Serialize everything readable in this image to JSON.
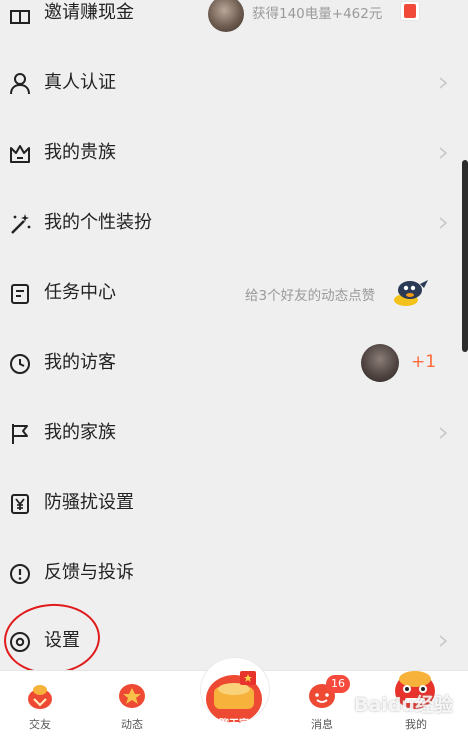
{
  "menu": {
    "items": [
      {
        "id": "invite",
        "label": "邀请赚现金",
        "hint": "获得140电量+462元"
      },
      {
        "id": "verify",
        "label": "真人认证"
      },
      {
        "id": "noble",
        "label": "我的贵族"
      },
      {
        "id": "dressup",
        "label": "我的个性装扮"
      },
      {
        "id": "tasks",
        "label": "任务中心",
        "hint": "给3个好友的动态点赞"
      },
      {
        "id": "visitors",
        "label": "我的访客",
        "badge": "+1"
      },
      {
        "id": "family",
        "label": "我的家族"
      },
      {
        "id": "antiharass",
        "label": "防骚扰设置"
      },
      {
        "id": "feedback",
        "label": "反馈与投诉"
      },
      {
        "id": "settings",
        "label": "设置"
      }
    ]
  },
  "tabbar": {
    "tabs": [
      {
        "label": "交友"
      },
      {
        "label": "动态"
      },
      {
        "label": "聊天室"
      },
      {
        "label": "消息",
        "count": "16"
      },
      {
        "label": "我的"
      }
    ]
  },
  "watermark": "Baidu经验",
  "colors": {
    "accent_red": "#f24a3a",
    "annotation_red": "#e01b1b",
    "hint_gray": "#9a9a9a",
    "background": "#efefef"
  }
}
